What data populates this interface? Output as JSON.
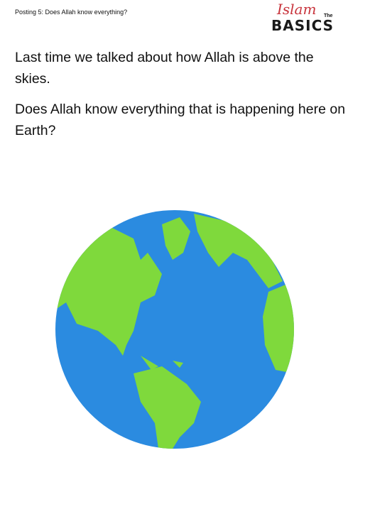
{
  "header": {
    "title": "Posting 5: Does Allah know everything?"
  },
  "logo": {
    "script_text": "Islam",
    "small_text": "The",
    "main_text": "BASICS",
    "script_color": "#c8343c"
  },
  "body": {
    "paragraphs": [
      "Last time we talked about how Allah is above the skies.",
      "Does Allah know everything that is happening here on Earth?"
    ]
  },
  "image": {
    "icon": "earth-globe-icon",
    "ocean_color": "#2b8be0",
    "land_color": "#7fd93c"
  }
}
